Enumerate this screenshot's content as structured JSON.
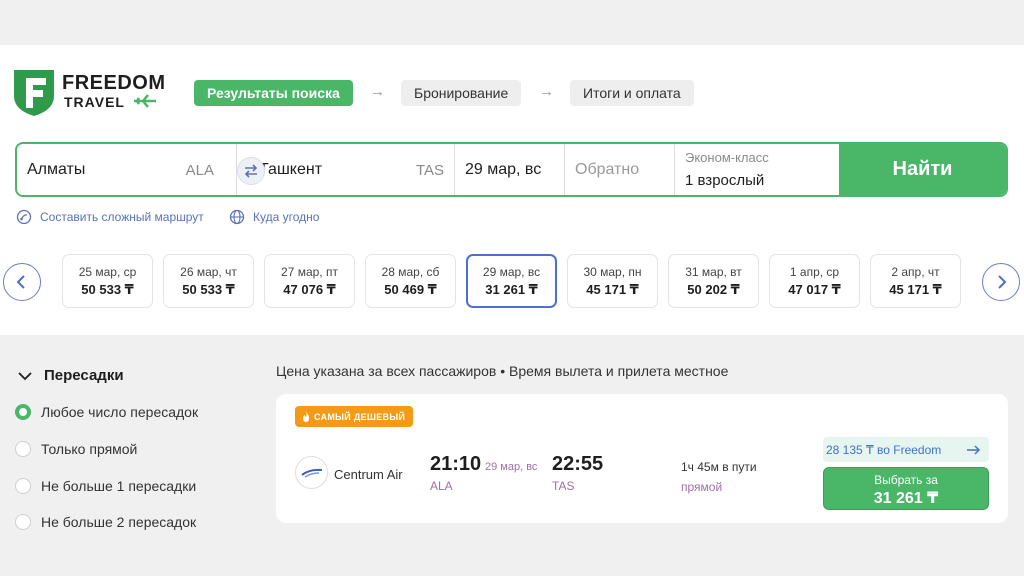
{
  "brand": {
    "line1": "FREEDOM",
    "line2": "TRAVEL"
  },
  "steps": [
    {
      "label": "Результаты поиска",
      "active": true
    },
    {
      "label": "Бронирование",
      "active": false
    },
    {
      "label": "Итоги и оплата",
      "active": false
    }
  ],
  "search": {
    "from_city": "Алматы",
    "from_code": "ALA",
    "to_city": "Ташкент",
    "to_code": "TAS",
    "date": "29 мар, вс",
    "return_placeholder": "Обратно",
    "cabin": "Эконом-класс",
    "passengers": "1 взрослый",
    "find_label": "Найти"
  },
  "links": {
    "complex_route": "Составить сложный маршрут",
    "anywhere": "Куда угодно"
  },
  "dates": [
    {
      "label": "25 мар, ср",
      "price": "50 533 ₸"
    },
    {
      "label": "26 мар, чт",
      "price": "50 533 ₸"
    },
    {
      "label": "27 мар, пт",
      "price": "47 076 ₸"
    },
    {
      "label": "28 мар, сб",
      "price": "50 469 ₸"
    },
    {
      "label": "29 мар, вс",
      "price": "31 261 ₸",
      "selected": true
    },
    {
      "label": "30 мар, пн",
      "price": "45 171 ₸"
    },
    {
      "label": "31 мар, вт",
      "price": "50 202 ₸"
    },
    {
      "label": "1 апр, ср",
      "price": "47 017 ₸"
    },
    {
      "label": "2 апр, чт",
      "price": "45 171 ₸"
    }
  ],
  "filters": {
    "title": "Пересадки",
    "options": [
      {
        "label": "Любое число пересадок",
        "checked": true
      },
      {
        "label": "Только прямой",
        "checked": false
      },
      {
        "label": "Не больше 1 пересадки",
        "checked": false
      },
      {
        "label": "Не больше 2 пересадок",
        "checked": false
      }
    ]
  },
  "results": {
    "note": "Цена указана за всех пассажиров • Время вылета и прилета местное",
    "flight": {
      "badge": "САМЫЙ ДЕШЕВЫЙ",
      "airline": "Centrum Air",
      "dep_time": "21:10",
      "dep_date": "29 мар, вс",
      "dep_code": "ALA",
      "arr_time": "22:55",
      "arr_code": "TAS",
      "duration": "1ч 45м в пути",
      "type": "прямой",
      "promo": "28 135 ₸ во Freedom",
      "select_label": "Выбрать за",
      "price": "31 261 ₸"
    }
  },
  "colors": {
    "green": "#4ab768",
    "blue": "#4d6fcf",
    "orange": "#f39b16",
    "purple": "#a06fa8"
  }
}
